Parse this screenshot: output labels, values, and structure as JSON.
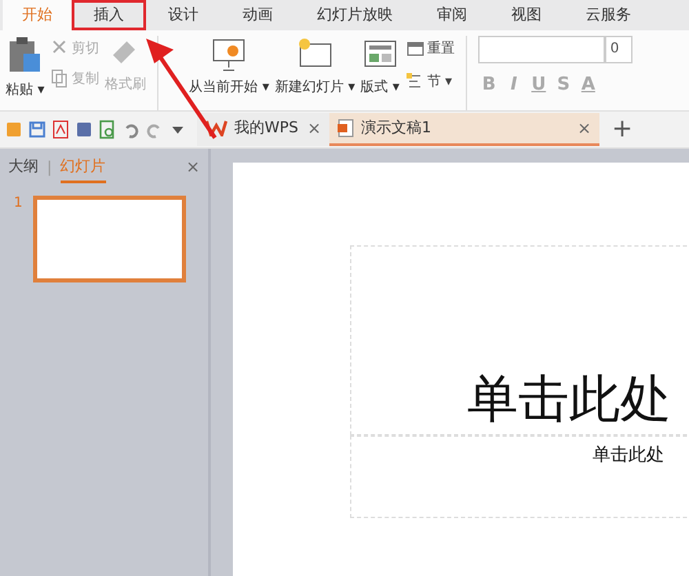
{
  "menu_tabs": [
    {
      "label": "开始",
      "selected": true,
      "highlighted": false
    },
    {
      "label": "插入",
      "selected": false,
      "highlighted": true
    },
    {
      "label": "设计",
      "selected": false,
      "highlighted": false
    },
    {
      "label": "动画",
      "selected": false,
      "highlighted": false
    },
    {
      "label": "幻灯片放映",
      "selected": false,
      "highlighted": false
    },
    {
      "label": "审阅",
      "selected": false,
      "highlighted": false
    },
    {
      "label": "视图",
      "selected": false,
      "highlighted": false
    },
    {
      "label": "云服务",
      "selected": false,
      "highlighted": false
    }
  ],
  "ribbon": {
    "paste": {
      "label": "粘贴",
      "dropdown": "▾"
    },
    "clipboard": [
      {
        "label": "剪切",
        "kind": "cut"
      },
      {
        "label": "复制",
        "kind": "copy"
      }
    ],
    "format_painter": {
      "label": "格式刷",
      "disabled": true
    },
    "slide_buttons": [
      {
        "label": "从当前开始",
        "dropdown": "▾",
        "kind": "play"
      },
      {
        "label": "新建幻灯片",
        "dropdown": "▾",
        "kind": "new"
      },
      {
        "label": "版式",
        "dropdown": "▾",
        "kind": "layout"
      }
    ],
    "small_buttons": [
      {
        "label": "重置",
        "kind": "reset"
      },
      {
        "label": "节",
        "dropdown": "▾",
        "kind": "section"
      }
    ],
    "font_size": "0",
    "format_buttons": [
      "B",
      "I",
      "U",
      "S",
      "A"
    ]
  },
  "doc_tabs": [
    {
      "label": "我的WPS",
      "close": "×",
      "selected": false,
      "kind": "home"
    },
    {
      "label": "演示文稿1",
      "close": "×",
      "selected": true,
      "kind": "doc"
    }
  ],
  "new_tab": "+",
  "side_panel": {
    "tabs": [
      {
        "label": "大纲",
        "selected": false
      },
      {
        "label": "幻灯片",
        "selected": true
      }
    ],
    "separator": "|",
    "close": "×",
    "slides": [
      {
        "number": "1",
        "selected": true
      }
    ]
  },
  "slide": {
    "title": "单击此处",
    "subtitle": "单击此处"
  }
}
